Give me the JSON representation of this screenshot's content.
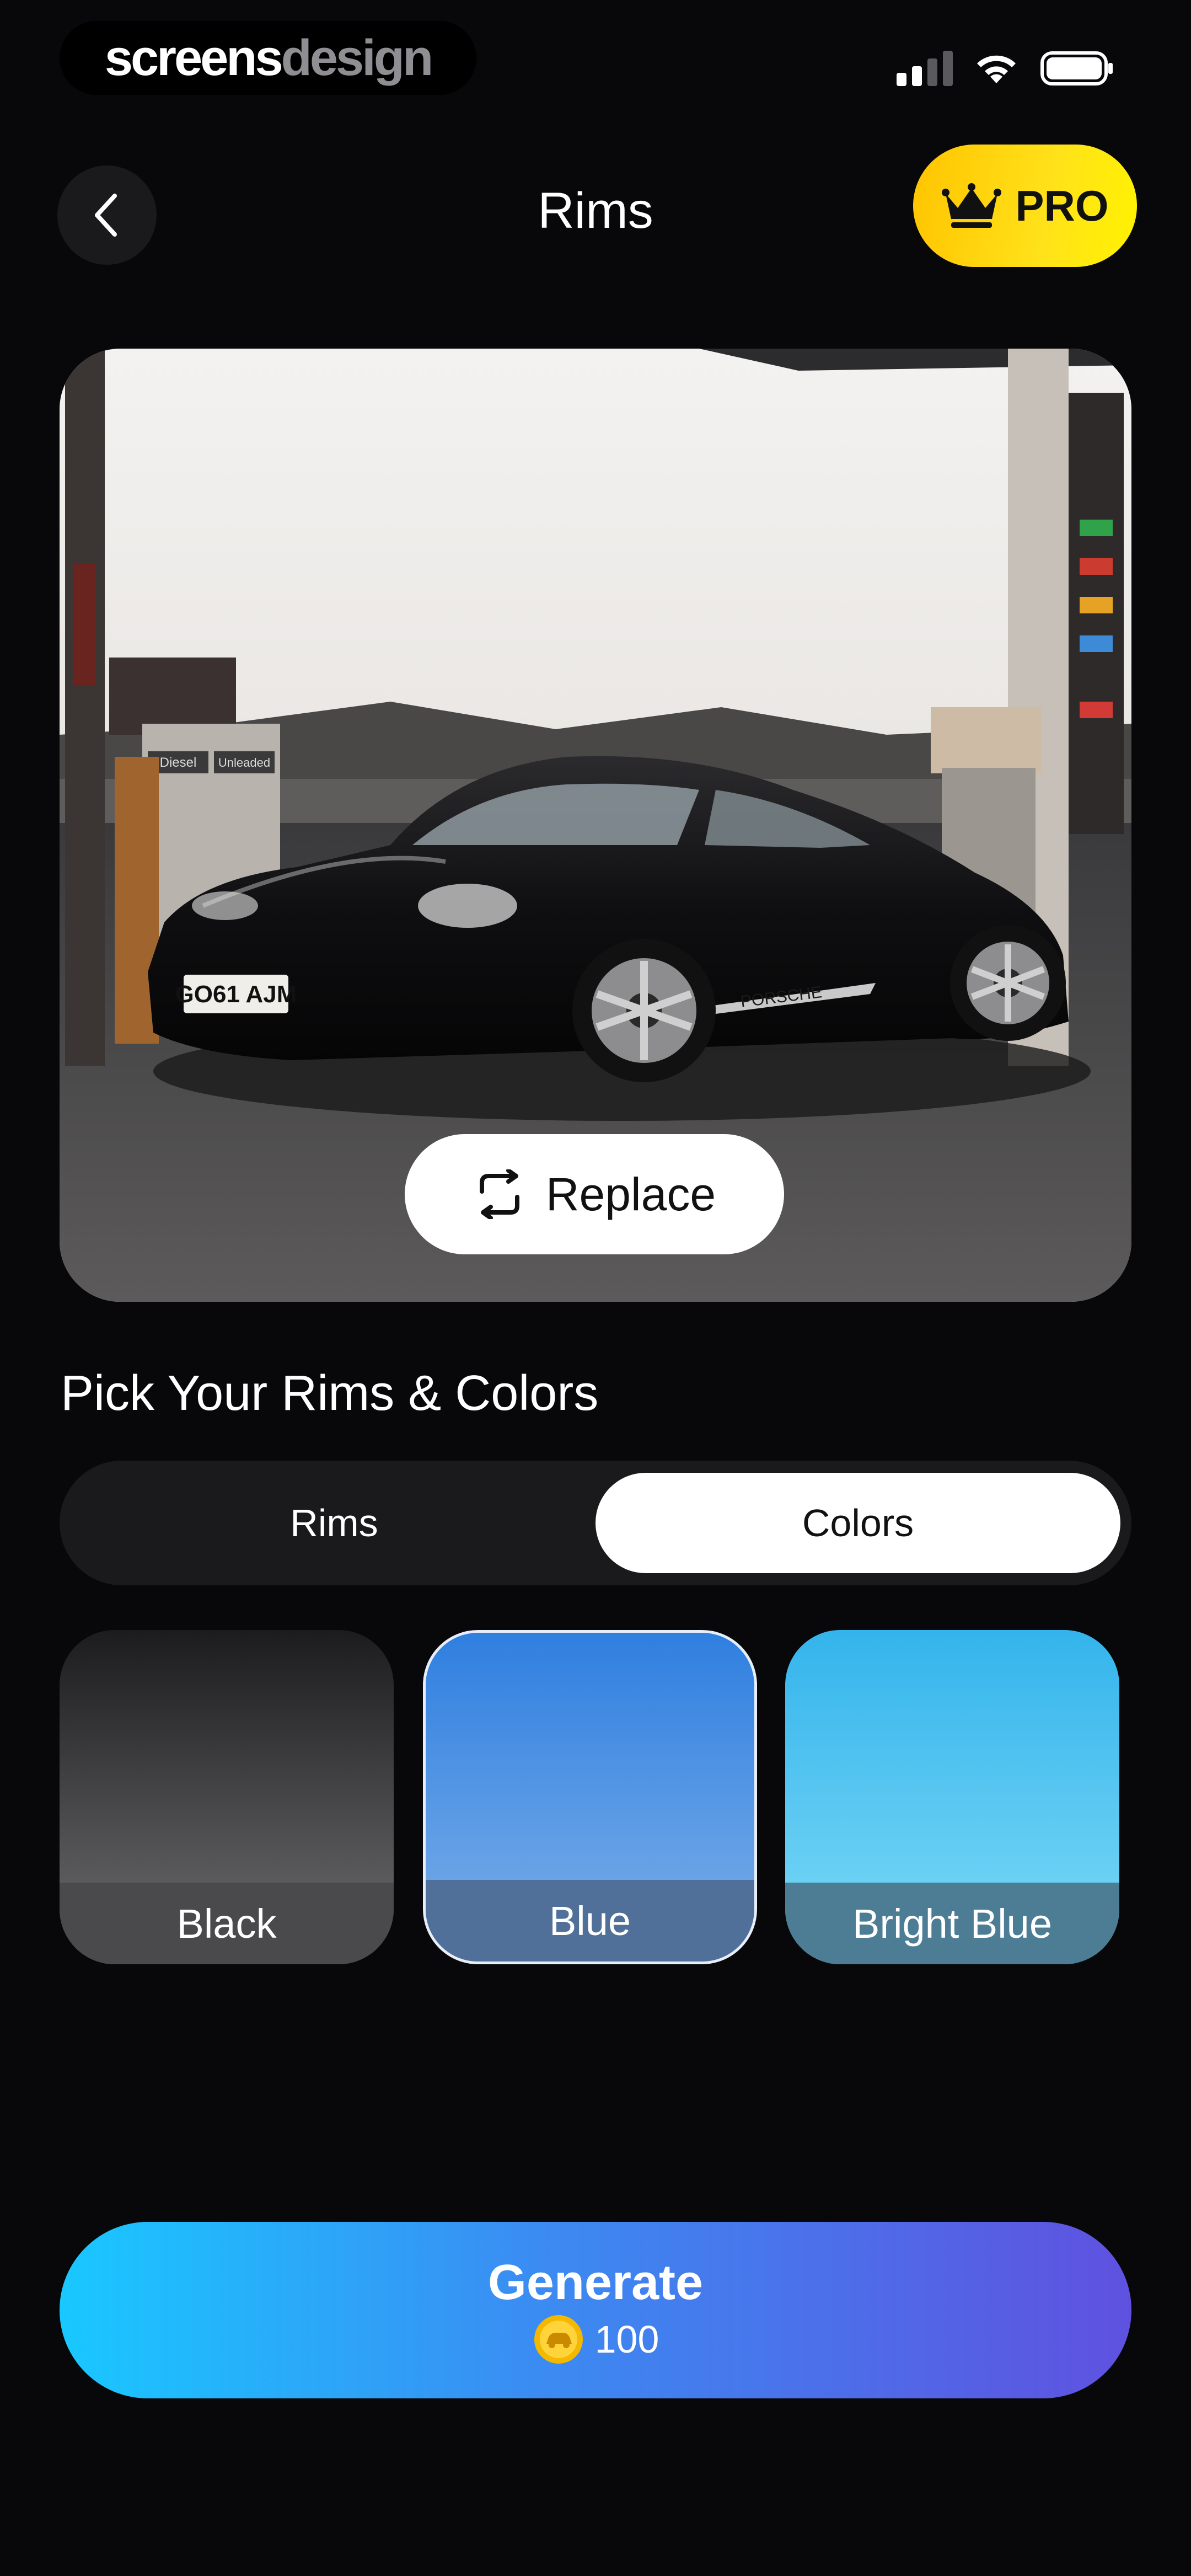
{
  "brand": {
    "part1": "screens",
    "part2": "design"
  },
  "header": {
    "title": "Rims",
    "pro_label": "PRO"
  },
  "photo": {
    "plate": "GO61 AJM",
    "pump_label_1": "Diesel",
    "pump_label_2": "Unleaded",
    "side_text": "PORSCHE"
  },
  "replace_label": "Replace",
  "section_title": "Pick Your Rims & Colors",
  "tabs": [
    {
      "label": "Rims",
      "selected": false
    },
    {
      "label": "Colors",
      "selected": true
    }
  ],
  "colors": [
    {
      "label": "Black",
      "selected": false
    },
    {
      "label": "Blue",
      "selected": true
    },
    {
      "label": "Bright Blue",
      "selected": false
    }
  ],
  "generate": {
    "label": "Generate",
    "cost": "100",
    "icon": "coin-icon"
  },
  "palette": {
    "pro_yellow": "#FFD400",
    "generate_start": "#19C8FF",
    "generate_end": "#5F51E0",
    "background": "#08080A"
  }
}
